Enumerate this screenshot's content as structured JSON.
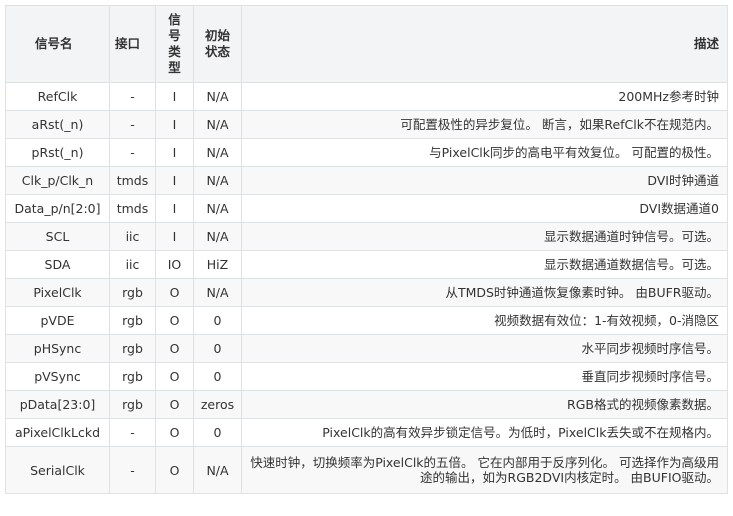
{
  "table": {
    "headers": {
      "name": "信号名",
      "port": "接口",
      "type": "信号类型",
      "init": "初始状态",
      "desc": "描述"
    },
    "rows": [
      {
        "name": "RefClk",
        "port": "-",
        "type": "I",
        "init": "N/A",
        "desc": "200MHz参考时钟"
      },
      {
        "name": "aRst(_n)",
        "port": "-",
        "type": "I",
        "init": "N/A",
        "desc": "可配置极性的异步复位。 断言，如果RefClk不在规范内。"
      },
      {
        "name": "pRst(_n)",
        "port": "-",
        "type": "I",
        "init": "N/A",
        "desc": "与PixelClk同步的高电平有效复位。 可配置的极性。"
      },
      {
        "name": "Clk_p/Clk_n",
        "port": "tmds",
        "type": "I",
        "init": "N/A",
        "desc": "DVI时钟通道"
      },
      {
        "name": "Data_p/n[2:0]",
        "port": "tmds",
        "type": "I",
        "init": "N/A",
        "desc": "DVI数据通道0"
      },
      {
        "name": "SCL",
        "port": "iic",
        "type": "I",
        "init": "N/A",
        "desc": "显示数据通道时钟信号。可选。"
      },
      {
        "name": "SDA",
        "port": "iic",
        "type": "IO",
        "init": "HiZ",
        "desc": "显示数据通道数据信号。可选。"
      },
      {
        "name": "PixelClk",
        "port": "rgb",
        "type": "O",
        "init": "N/A",
        "desc": "从TMDS时钟通道恢复像素时钟。 由BUFR驱动。"
      },
      {
        "name": "pVDE",
        "port": "rgb",
        "type": "O",
        "init": "0",
        "desc": "视频数据有效位：1-有效视频，0-消隐区"
      },
      {
        "name": "pHSync",
        "port": "rgb",
        "type": "O",
        "init": "0",
        "desc": "水平同步视频时序信号。"
      },
      {
        "name": "pVSync",
        "port": "rgb",
        "type": "O",
        "init": "0",
        "desc": "垂直同步视频时序信号。"
      },
      {
        "name": "pData[23:0]",
        "port": "rgb",
        "type": "O",
        "init": "zeros",
        "desc": "RGB格式的视频像素数据。"
      },
      {
        "name": "aPixelClkLckd",
        "port": "-",
        "type": "O",
        "init": "0",
        "desc": "PixelClk的高有效异步锁定信号。为低时，PixelClk丢失或不在规格内。"
      },
      {
        "name": "SerialClk",
        "port": "-",
        "type": "O",
        "init": "N/A",
        "desc": "快速时钟，切换频率为PixelClk的五倍。 它在内部用于反序列化。 可选择作为高级用途的输出，如为RGB2DVI内核定时。 由BUFIO驱动。"
      }
    ]
  }
}
